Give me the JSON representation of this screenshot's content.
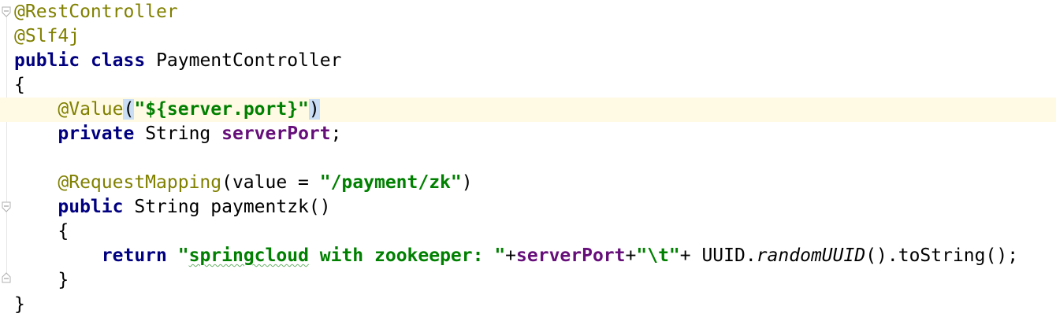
{
  "colors": {
    "keyword": "#000080",
    "annotation": "#808000",
    "string": "#008000",
    "field": "#660e7a",
    "current_line": "#fffae3",
    "brace_match": "#c9def5",
    "background": "#ffffff"
  },
  "icons": {
    "intention": "lightbulb-icon",
    "fold": "fold-marker-icon"
  },
  "code": {
    "l1": {
      "ann": "@RestController"
    },
    "l2": {
      "ann": "@Slf4j"
    },
    "l3": {
      "kw1": "public",
      "kw2": "class",
      "name": "PaymentController"
    },
    "l4": {
      "brace": "{"
    },
    "l5": {
      "ann": "@Value",
      "open": "(",
      "str": "\"${server.port}\"",
      "close": ")"
    },
    "l6": {
      "kw": "private",
      "type": "String",
      "field": "serverPort",
      "semi": ";"
    },
    "l8": {
      "ann": "@RequestMapping",
      "open": "(value = ",
      "str": "\"/payment/zk\"",
      "close": ")"
    },
    "l9": {
      "kw": "public",
      "rest": "String paymentzk()"
    },
    "l10": {
      "brace": "{"
    },
    "l11": {
      "kw": "return",
      "str_a": "\"",
      "str_b": "springcloud",
      "str_c": " with zookeeper: \"",
      "plus1": "+",
      "field": "serverPort",
      "plus2": "+",
      "str2": "\"\\t\"",
      "plus3": "+ UUID.",
      "method": "randomUUID",
      "tail": "().toString();"
    },
    "l12": {
      "brace": "}"
    },
    "l13": {
      "brace": "}"
    }
  }
}
